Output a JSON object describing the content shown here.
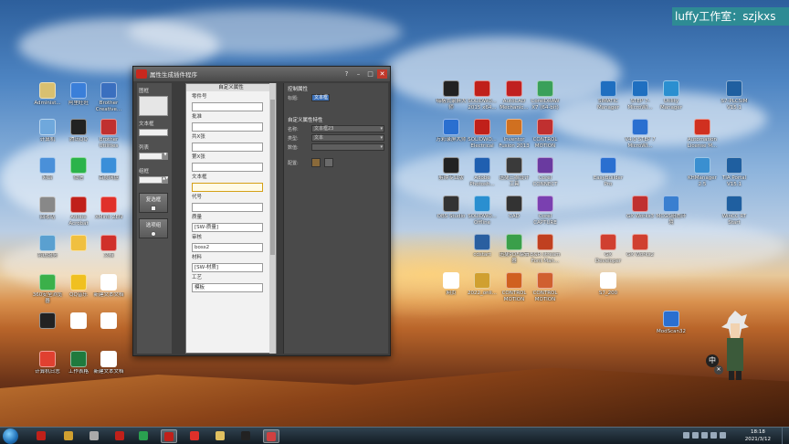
{
  "watermark": "luffy工作室：szjkxs",
  "desktop_icons_left": [
    {
      "label": "Administ...",
      "color": "#d9c070"
    },
    {
      "label": "计算机",
      "color": "#6fa8dc"
    },
    {
      "label": "网络",
      "color": "#4a90d9"
    },
    {
      "label": "回收站",
      "color": "#888888"
    },
    {
      "label": "系统服务",
      "color": "#5aa0d0"
    },
    {
      "label": "360安全浏览器",
      "color": "#3bb04a"
    },
    {
      "label": "",
      "color": "#222222"
    },
    {
      "label": "",
      "color": "#e04030"
    },
    {
      "label": "计算机日志",
      "color": "#ffffff"
    }
  ],
  "desktop_icons_col2": [
    {
      "label": "阿里旺旺",
      "color": "#3a7fd9"
    },
    {
      "label": "腾讯QQ",
      "color": "#222222"
    },
    {
      "label": "微信",
      "color": "#2bb34a"
    },
    {
      "label": "Adobe Acrobat",
      "color": "#c0201a"
    },
    {
      "label": "",
      "color": "#f0c040"
    },
    {
      "label": "QQ音乐",
      "color": "#f0c020"
    },
    {
      "label": "",
      "color": "#ffffff"
    },
    {
      "label": "工作表格",
      "color": "#1f7a3d"
    }
  ],
  "desktop_icons_col3": [
    {
      "label": "Brother Creative...",
      "color": "#3a6fbf"
    },
    {
      "label": "Brother Utilities",
      "color": "#c03030"
    },
    {
      "label": "百度网盘",
      "color": "#3a8fd9"
    },
    {
      "label": "XMind ZEN",
      "color": "#e0302a"
    },
    {
      "label": "文档",
      "color": "#d0302a"
    },
    {
      "label": "新建文本文档",
      "color": "#ffffff"
    },
    {
      "label": "",
      "color": "#ffffff"
    },
    {
      "label": "新建文本文档",
      "color": "#ffffff"
    }
  ],
  "desktop_icons_right": [
    {
      "label": "嗨格式录屏大师",
      "color": "#222222"
    },
    {
      "label": "万彩录屏大师",
      "color": "#2a6fd0"
    },
    {
      "label": "剪映专业版",
      "color": "#222222"
    },
    {
      "label": "OBS Studio",
      "color": "#333333"
    },
    {
      "label": "cdstart",
      "color": "#2a5fa0"
    },
    {
      "label": "网页",
      "color": "#ffffff"
    },
    {
      "label": "SOLIDWO... 2015 x64...",
      "color": "#c0201a"
    },
    {
      "label": "SOLIDWO... Electrical",
      "color": "#c0201a"
    },
    {
      "label": "Adobe Photosh...",
      "color": "#1f5fb0"
    },
    {
      "label": "SOLIDWO... Offline",
      "color": "#2a8fd0"
    },
    {
      "label": "",
      "color": "#2a70c0"
    },
    {
      "label": "2022_onli...",
      "color": "#d0a030"
    },
    {
      "label": "AutoCAD Mechanic...",
      "color": "#c02020"
    },
    {
      "label": "Inventor Fusion 2013",
      "color": "#d07020"
    },
    {
      "label": "迅捷三维设计工具",
      "color": "#3a3a3a"
    },
    {
      "label": "CAD",
      "color": "#333333"
    },
    {
      "label": "迅捷PDF编辑器",
      "color": "#3a9f4a"
    },
    {
      "label": "CONTROL MOTION",
      "color": "#d06020"
    },
    {
      "label": "CorelDRAW X7 (64-bit)",
      "color": "#3aa05a"
    },
    {
      "label": "CONTROL MOTION",
      "color": "#c03030"
    },
    {
      "label": "Corel CONNECT",
      "color": "#6a3aa0"
    },
    {
      "label": "Corel CAPTURE",
      "color": "#7a40b0"
    },
    {
      "label": "B&R stream Font Man...",
      "color": "#c04020"
    },
    {
      "label": "CONTROL MOTION",
      "color": "#d06030"
    }
  ],
  "desktop_icons_far_right": [
    {
      "label": "SIMATIC Manager",
      "color": "#1f6fc0"
    },
    {
      "label": "STEP 7-MicroWI...",
      "color": "#1f6fc0"
    },
    {
      "label": "Utility Manager",
      "color": "#2a8fd0"
    },
    {
      "label": "Automation License M...",
      "color": "#d03020"
    },
    {
      "label": "S7-PLCSIM V15.1",
      "color": "#1f5fa0"
    },
    {
      "label": "GX Works2",
      "color": "#d04030"
    },
    {
      "label": "GX Developer",
      "color": "#d04030"
    },
    {
      "label": "S7_200",
      "color": "#ffffff"
    },
    {
      "label": "EasyBuilder Pro",
      "color": "#2a6fd0"
    },
    {
      "label": "V4.0 STEP 7 MicroWI...",
      "color": "#2a6fd0"
    },
    {
      "label": "KHManager 2.5",
      "color": "#3a8fd0"
    },
    {
      "label": "TIA Portal V15.1",
      "color": "#1f5fa0"
    },
    {
      "label": "WinCC RT Start",
      "color": "#1f5fa0"
    },
    {
      "label": "GX Works3",
      "color": "#c03030"
    },
    {
      "label": "MCGS组态环境",
      "color": "#3a7fd0"
    },
    {
      "label": "ModScan32",
      "color": "#2a6fd0"
    }
  ],
  "window": {
    "title": "属性生成插件程序",
    "palette": [
      {
        "label": "图框"
      },
      {
        "label": "文本框"
      },
      {
        "label": "列表"
      },
      {
        "label": "组框"
      },
      {
        "label": "复选框"
      },
      {
        "label": "选项组"
      }
    ],
    "form_header": "自定义属性",
    "fields": [
      {
        "label": "零件号",
        "value": ""
      },
      {
        "label": "批准",
        "value": ""
      },
      {
        "label": "共X张",
        "value": ""
      },
      {
        "label": "第X张",
        "value": ""
      },
      {
        "label": "文本框",
        "value": ""
      },
      {
        "label": "代号",
        "value": ""
      },
      {
        "label": "质量",
        "value": "[SW-质量]"
      },
      {
        "label": "审核",
        "value": "boss2"
      },
      {
        "label": "材料",
        "value": "[SW-材质]"
      },
      {
        "label": "工艺",
        "value": "模板"
      }
    ],
    "props": {
      "control_header": "控制属性",
      "label_label": "标题:",
      "label_value": "文本框",
      "custom_header": "自定义属性特性",
      "name_label": "名称:",
      "name_value": "文本框23",
      "type_label": "类型:",
      "type_value": "文本",
      "value_label": "数值:",
      "value_value": "",
      "align_label": "配置:"
    }
  },
  "taskbar": {
    "time": "18:18",
    "date": "2021/3/12"
  }
}
